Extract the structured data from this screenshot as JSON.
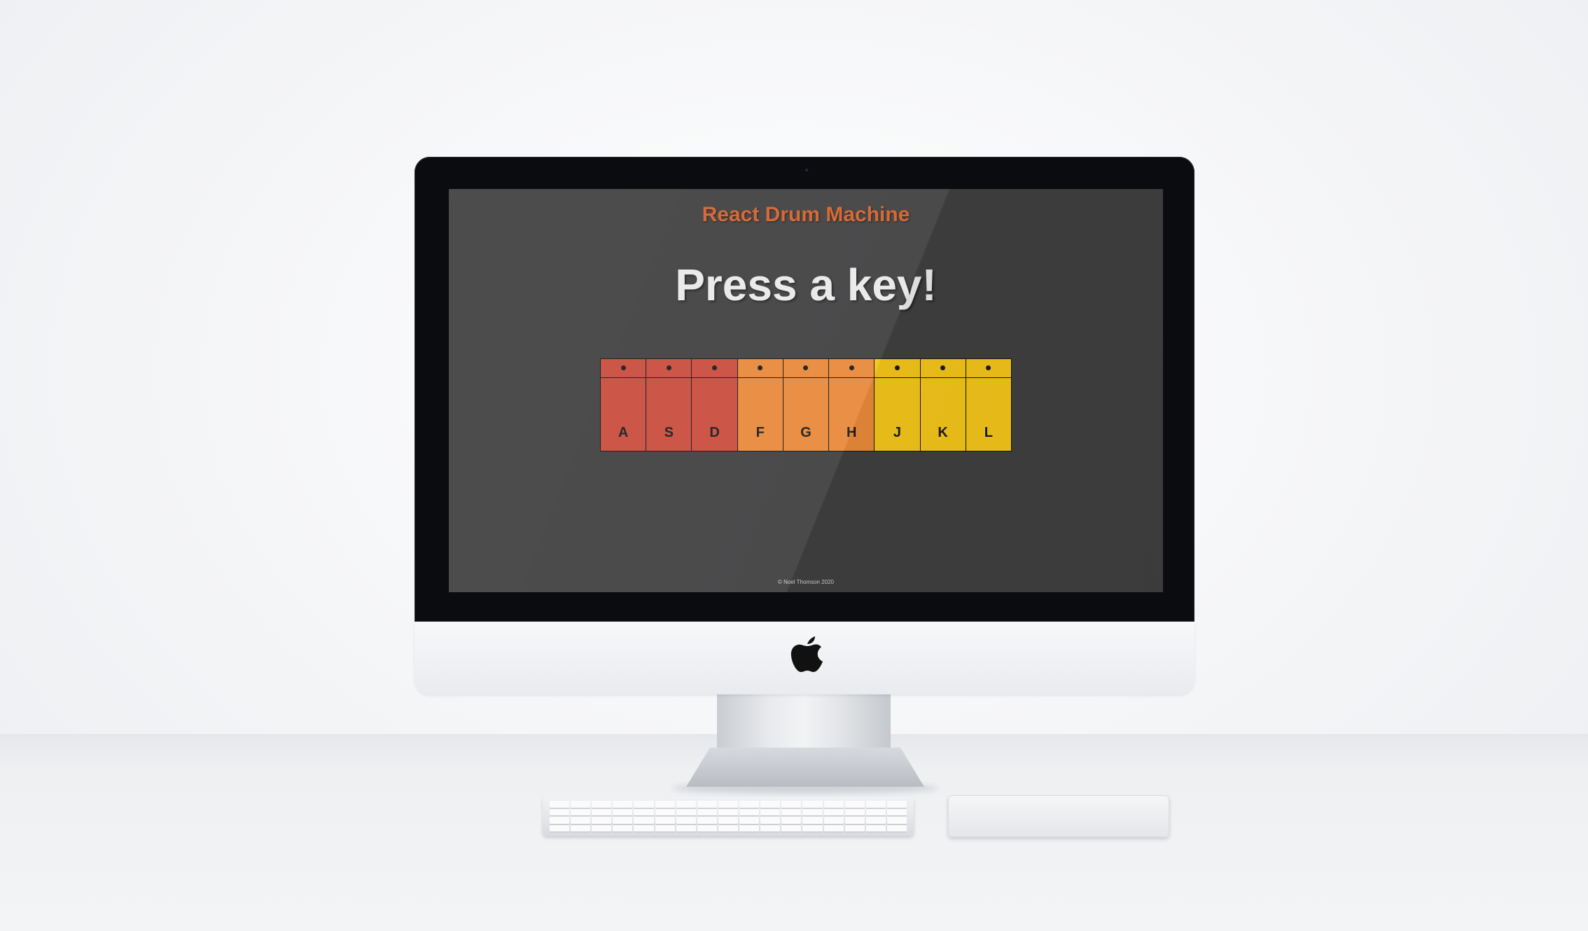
{
  "app": {
    "title": "React Drum Machine",
    "heading": "Press a key!",
    "footer": "© Noel Thomson 2020"
  },
  "drum_pads": [
    {
      "key": "A",
      "color": "#c94b3c"
    },
    {
      "key": "S",
      "color": "#c94b3c"
    },
    {
      "key": "D",
      "color": "#c94b3c"
    },
    {
      "key": "F",
      "color": "#e8893a"
    },
    {
      "key": "G",
      "color": "#e8893a"
    },
    {
      "key": "H",
      "color": "#e8893a"
    },
    {
      "key": "J",
      "color": "#f2c419"
    },
    {
      "key": "K",
      "color": "#f2c419"
    },
    {
      "key": "L",
      "color": "#f2c419"
    }
  ],
  "colors": {
    "title_accent": "#d4602a",
    "screen_background": "#3f3f40",
    "heading_text": "#e9e9ea"
  },
  "scene": {
    "device": "imac",
    "logo_icon": "apple-logo-icon",
    "peripherals": [
      "keyboard",
      "trackpad"
    ]
  }
}
